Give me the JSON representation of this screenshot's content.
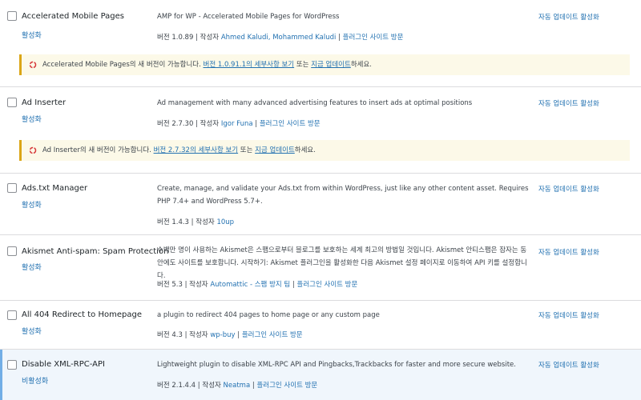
{
  "auto_update_label": "자동 업데이트 활성화",
  "plugins": [
    {
      "name": "Accelerated Mobile Pages",
      "action": "활성화",
      "description": "AMP for WP - Accelerated Mobile Pages for WordPress",
      "version_label": "버전 1.0.89",
      "author_prefix": "작성자",
      "author": "Ahmed Kaludi, Mohammed Kaludi",
      "site_link": "플러그인 사이트 방문",
      "notice": {
        "prefix": "Accelerated Mobile Pages의 새 버전이 가능합니다. ",
        "details": "버전 1.0.91.1의 세부사항 보기",
        "mid": " 또는 ",
        "update": "지금 업데이트",
        "suffix": "하세요."
      }
    },
    {
      "name": "Ad Inserter",
      "action": "활성화",
      "description": "Ad management with many advanced advertising features to insert ads at optimal positions",
      "version_label": "버전 2.7.30",
      "author_prefix": "작성자",
      "author": "Igor Funa",
      "site_link": "플러그인 사이트 방문",
      "notice": {
        "prefix": "Ad Inserter의 새 버전이 가능합니다. ",
        "details": "버전 2.7.32의 세부사항 보기",
        "mid": " 또는 ",
        "update": "지금 업데이트",
        "suffix": "하세요."
      }
    },
    {
      "name": "Ads.txt Manager",
      "action": "활성화",
      "description": "Create, manage, and validate your Ads.txt from within WordPress, just like any other content asset. Requires PHP 7.4+ and WordPress 5.7+.",
      "version_label": "버전 1.4.3",
      "author_prefix": "작성자",
      "author": "10up",
      "site_link": ""
    },
    {
      "name": "Akismet Anti-spam: Spam Protection",
      "action": "활성화",
      "description": "수백만 명이 사용하는 Akismet은 스팸으로부터 블로그를 보호하는 세계 최고의 방법일 것입니다. Akismet 안티스팸은 잠자는 동안에도 사이트를 보호합니다. 시작하기: Akismet 플러그인을 활성화한 다음 Akismet 설정 페이지로 이동하여 API 키를 설정합니다.",
      "version_label": "버전 5.3",
      "author_prefix": "작성자",
      "author": "Automattic - 스팸 방지 팀",
      "site_link": "플러그인 사이트 방문"
    },
    {
      "name": "All 404 Redirect to Homepage",
      "action": "활성화",
      "description": "a plugin to redirect 404 pages to home page or any custom page",
      "version_label": "버전 4.3",
      "author_prefix": "작성자",
      "author": "wp-buy",
      "site_link": "플러그인 사이트 방문"
    },
    {
      "name": "Disable XML-RPC-API",
      "action": "비활성화",
      "description": "Lightweight plugin to disable XML-RPC API and Pingbacks,Trackbacks for faster and more secure website.",
      "version_label": "버전 2.1.4.4",
      "author_prefix": "작성자",
      "author": "Neatma",
      "site_link": "플러그인 사이트 방문"
    }
  ],
  "colors": {
    "link": "#2271b1",
    "notice_border": "#dba617",
    "notice_bg": "#fcf9e8",
    "active_bar": "#72aee6"
  }
}
